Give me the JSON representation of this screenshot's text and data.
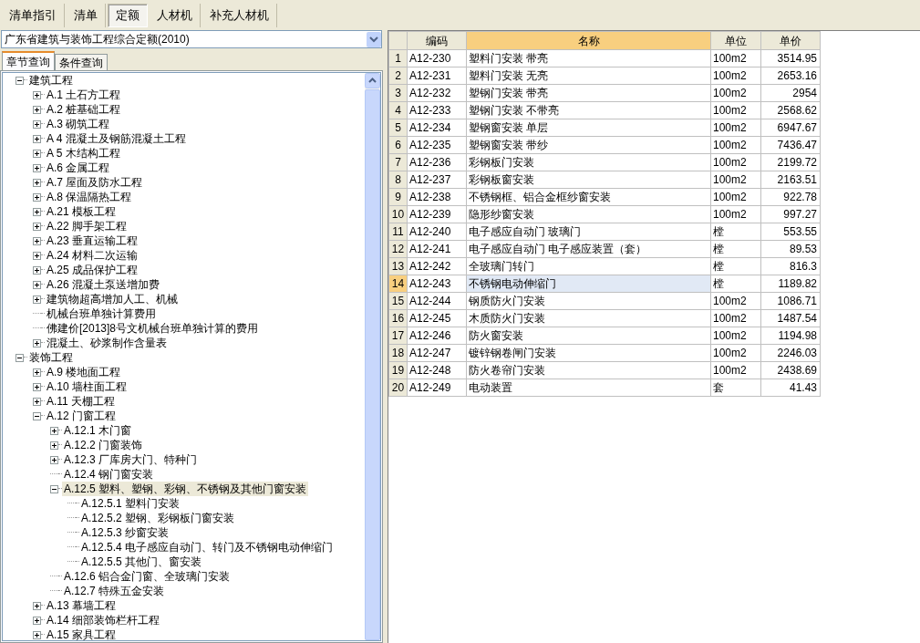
{
  "top_tabs": [
    {
      "label": "清单指引",
      "selected": false
    },
    {
      "label": "清单",
      "selected": false
    },
    {
      "label": "定额",
      "selected": true
    },
    {
      "label": "人材机",
      "selected": false
    },
    {
      "label": "补充人材机",
      "selected": false
    }
  ],
  "quota_dropdown": {
    "value": "广东省建筑与装饰工程综合定额(2010)"
  },
  "query_tabs": [
    {
      "label": "章节查询",
      "selected": true
    },
    {
      "label": "条件查询",
      "selected": false
    }
  ],
  "tree": [
    {
      "label": "建筑工程",
      "expanded": true,
      "selected": false,
      "children": [
        {
          "label": "A.1 土石方工程",
          "expanded": false,
          "selected": false
        },
        {
          "label": "A.2 桩基础工程",
          "expanded": false,
          "selected": false
        },
        {
          "label": "A.3 砌筑工程",
          "expanded": false,
          "selected": false
        },
        {
          "label": "A 4 混凝土及钢筋混凝土工程",
          "expanded": false,
          "selected": false
        },
        {
          "label": "A 5 木结构工程",
          "expanded": false,
          "selected": false
        },
        {
          "label": "A.6 金属工程",
          "expanded": false,
          "selected": false
        },
        {
          "label": "A.7 屋面及防水工程",
          "expanded": false,
          "selected": false
        },
        {
          "label": "A.8 保温隔热工程",
          "expanded": false,
          "selected": false
        },
        {
          "label": "A.21 模板工程",
          "expanded": false,
          "selected": false
        },
        {
          "label": "A.22 脚手架工程",
          "expanded": false,
          "selected": false
        },
        {
          "label": "A.23 垂直运输工程",
          "expanded": false,
          "selected": false
        },
        {
          "label": "A.24 材料二次运输",
          "expanded": false,
          "selected": false
        },
        {
          "label": "A.25 成品保护工程",
          "expanded": false,
          "selected": false
        },
        {
          "label": "A.26 混凝土泵送增加费",
          "expanded": false,
          "selected": false
        },
        {
          "label": "建筑物超高增加人工、机械",
          "expanded": false,
          "selected": false
        },
        {
          "label": "机械台班单独计算费用",
          "selected": false
        },
        {
          "label": "佛建价[2013]8号文机械台班单独计算的费用",
          "selected": false
        },
        {
          "label": "混凝土、砂浆制作含量表",
          "expanded": false,
          "selected": false
        }
      ]
    },
    {
      "label": "装饰工程",
      "expanded": true,
      "selected": false,
      "children": [
        {
          "label": "A.9 楼地面工程",
          "expanded": false,
          "selected": false
        },
        {
          "label": "A.10 墙柱面工程",
          "expanded": false,
          "selected": false
        },
        {
          "label": "A.11 天棚工程",
          "expanded": false,
          "selected": false
        },
        {
          "label": "A.12 门窗工程",
          "expanded": true,
          "selected": false,
          "children": [
            {
              "label": "A.12.1 木门窗",
              "expanded": false,
              "selected": false
            },
            {
              "label": "A.12.2 门窗装饰",
              "expanded": false,
              "selected": false
            },
            {
              "label": "A.12.3 厂库房大门、特种门",
              "expanded": false,
              "selected": false
            },
            {
              "label": "A.12.4 钢门窗安装",
              "selected": false
            },
            {
              "label": "A.12.5 塑料、塑钢、彩钢、不锈钢及其他门窗安装",
              "expanded": true,
              "selected": true,
              "children": [
                {
                  "label": "A.12.5.1 塑料门安装",
                  "selected": false
                },
                {
                  "label": "A.12.5.2 塑钢、彩钢板门窗安装",
                  "selected": false
                },
                {
                  "label": "A.12.5.3 纱窗安装",
                  "selected": false
                },
                {
                  "label": "A.12.5.4 电子感应自动门、转门及不锈钢电动伸缩门",
                  "selected": false
                },
                {
                  "label": "A.12.5.5 其他门、窗安装",
                  "selected": false
                }
              ]
            },
            {
              "label": "A.12.6 铝合金门窗、全玻璃门安装",
              "selected": false
            },
            {
              "label": "A.12.7 特殊五金安装",
              "selected": false
            }
          ]
        },
        {
          "label": "A.13 幕墙工程",
          "expanded": false,
          "selected": false
        },
        {
          "label": "A.14 细部装饰栏杆工程",
          "expanded": false,
          "selected": false
        },
        {
          "label": "A.15 家具工程",
          "expanded": false,
          "selected": false
        }
      ]
    }
  ],
  "table": {
    "columns": [
      {
        "label": "编码",
        "selected": false
      },
      {
        "label": "名称",
        "selected": true
      },
      {
        "label": "单位",
        "selected": false
      },
      {
        "label": "单价",
        "selected": false
      }
    ],
    "rows": [
      {
        "no": "1",
        "code": "A12-230",
        "name": "塑料门安装 带亮",
        "unit": "100m2",
        "price": "3514.95",
        "selected": false
      },
      {
        "no": "2",
        "code": "A12-231",
        "name": "塑料门安装 无亮",
        "unit": "100m2",
        "price": "2653.16",
        "selected": false
      },
      {
        "no": "3",
        "code": "A12-232",
        "name": "塑钢门安装 带亮",
        "unit": "100m2",
        "price": "2954",
        "selected": false
      },
      {
        "no": "4",
        "code": "A12-233",
        "name": "塑钢门安装 不带亮",
        "unit": "100m2",
        "price": "2568.62",
        "selected": false
      },
      {
        "no": "5",
        "code": "A12-234",
        "name": "塑钢窗安装 单层",
        "unit": "100m2",
        "price": "6947.67",
        "selected": false
      },
      {
        "no": "6",
        "code": "A12-235",
        "name": "塑钢窗安装 带纱",
        "unit": "100m2",
        "price": "7436.47",
        "selected": false
      },
      {
        "no": "7",
        "code": "A12-236",
        "name": "彩钢板门安装",
        "unit": "100m2",
        "price": "2199.72",
        "selected": false
      },
      {
        "no": "8",
        "code": "A12-237",
        "name": "彩钢板窗安装",
        "unit": "100m2",
        "price": "2163.51",
        "selected": false
      },
      {
        "no": "9",
        "code": "A12-238",
        "name": "不锈钢框、铝合金框纱窗安装",
        "unit": "100m2",
        "price": "922.78",
        "selected": false
      },
      {
        "no": "10",
        "code": "A12-239",
        "name": "隐形纱窗安装",
        "unit": "100m2",
        "price": "997.27",
        "selected": false
      },
      {
        "no": "11",
        "code": "A12-240",
        "name": "电子感应自动门 玻璃门",
        "unit": "樘",
        "price": "553.55",
        "selected": false
      },
      {
        "no": "12",
        "code": "A12-241",
        "name": "电子感应自动门 电子感应装置（套）",
        "unit": "樘",
        "price": "89.53",
        "selected": false
      },
      {
        "no": "13",
        "code": "A12-242",
        "name": "全玻璃门转门",
        "unit": "樘",
        "price": "816.3",
        "selected": false
      },
      {
        "no": "14",
        "code": "A12-243",
        "name": "不锈钢电动伸缩门",
        "unit": "樘",
        "price": "1189.82",
        "selected": true
      },
      {
        "no": "15",
        "code": "A12-244",
        "name": "钢质防火门安装",
        "unit": "100m2",
        "price": "1086.71",
        "selected": false
      },
      {
        "no": "16",
        "code": "A12-245",
        "name": "木质防火门安装",
        "unit": "100m2",
        "price": "1487.54",
        "selected": false
      },
      {
        "no": "17",
        "code": "A12-246",
        "name": "防火窗安装",
        "unit": "100m2",
        "price": "1194.98",
        "selected": false
      },
      {
        "no": "18",
        "code": "A12-247",
        "name": "镀锌钢卷闸门安装",
        "unit": "100m2",
        "price": "2246.03",
        "selected": false
      },
      {
        "no": "19",
        "code": "A12-248",
        "name": "防火卷帘门安装",
        "unit": "100m2",
        "price": "2438.69",
        "selected": false
      },
      {
        "no": "20",
        "code": "A12-249",
        "name": "电动装置",
        "unit": "套",
        "price": "41.43",
        "selected": false
      }
    ]
  }
}
